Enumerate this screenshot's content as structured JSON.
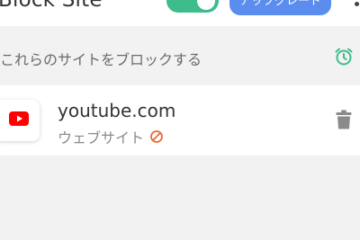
{
  "header": {
    "app_title": "Block Site",
    "toggle_on": true,
    "upgrade_label": "アップグレード",
    "colors": {
      "toggle": "#3dbd8c",
      "upgrade": "#5b8def"
    }
  },
  "section": {
    "title": "これらのサイトをブロックする",
    "schedule_icon": "alarm-clock-icon",
    "accent": "#3dbd8c"
  },
  "blocked_sites": [
    {
      "domain": "youtube.com",
      "type_label": "ウェブサイト",
      "logo_icon": "youtube-logo-icon",
      "status_icon": "blocked-icon",
      "action_icon": "trash-icon"
    }
  ]
}
